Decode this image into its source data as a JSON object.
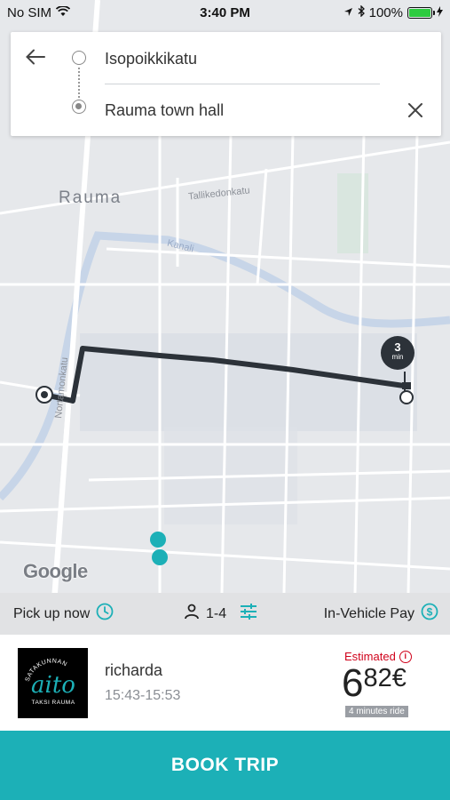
{
  "status_bar": {
    "carrier": "No SIM",
    "time": "3:40 PM",
    "battery": "100%",
    "battery_level": 1.0
  },
  "search": {
    "origin": "Isopoikkikatu",
    "destination": "Rauma town hall"
  },
  "map": {
    "city_label": "Rauma",
    "street_labels": [
      "Tallikedonkatu",
      "Kanali",
      "Nortamonkatu"
    ],
    "eta_value": "3",
    "eta_unit": "min",
    "provider": "Google"
  },
  "options": {
    "pickup": "Pick up now",
    "passengers": "1-4",
    "payment": "In-Vehicle Pay"
  },
  "ride": {
    "provider_name": "richarda",
    "time_window": "15:43-15:53",
    "estimated_label": "Estimated",
    "price_int": "6",
    "price_dec": "82€",
    "duration": "4 minutes ride",
    "logo_text_top": "SATAKUNNAN",
    "logo_text_main": "aito",
    "logo_text_bottom": "TAKSI RAUMA"
  },
  "actions": {
    "book": "BOOK TRIP"
  },
  "colors": {
    "accent": "#1cb0b7",
    "estimated": "#d0021b",
    "route": "#2c3239"
  },
  "icons": [
    "wifi-icon",
    "location-arrow-icon",
    "bluetooth-icon",
    "battery-icon",
    "charging-icon",
    "back-arrow-icon",
    "close-icon",
    "clock-icon",
    "person-icon",
    "filter-icon",
    "dollar-icon",
    "info-icon",
    "map-pin-icon"
  ]
}
